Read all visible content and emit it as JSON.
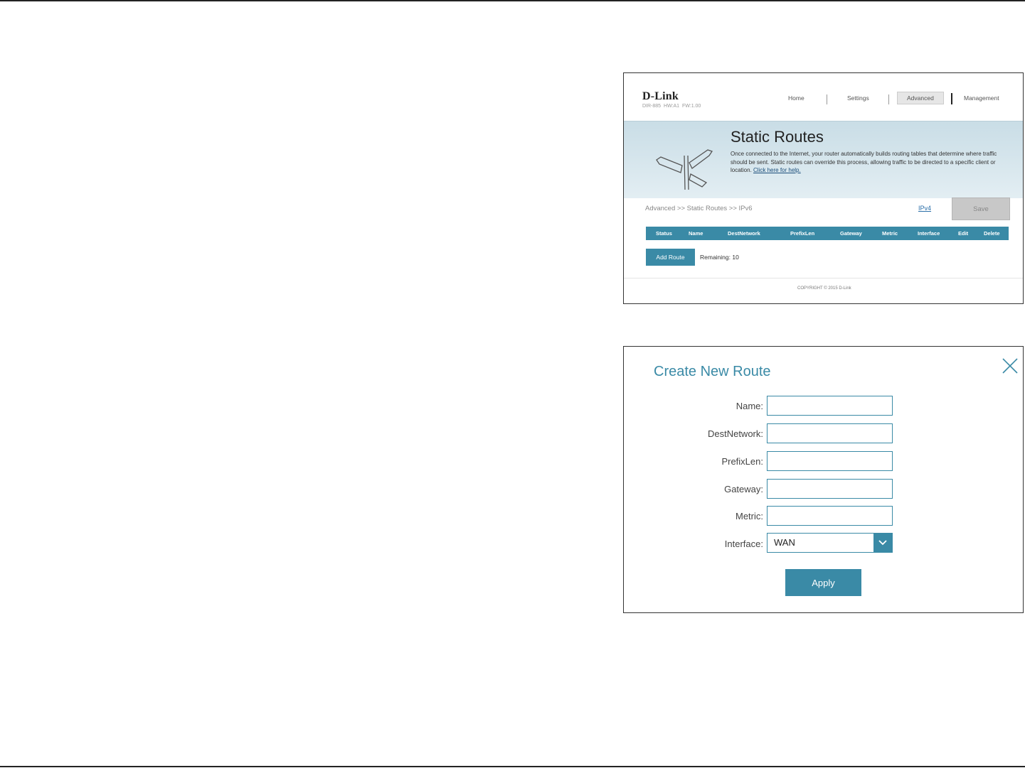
{
  "static_routes": {
    "logo": "D-Link",
    "model_info": "DIR-885   HW:A1   FW:1.00",
    "nav": {
      "home": "Home",
      "settings": "Settings",
      "advanced": "Advanced",
      "management": "Management"
    },
    "banner": {
      "title": "Static Routes",
      "description": "Once connected to the Internet, your router automatically builds routing tables that determine where traffic should be sent. Static routes can override this process, allowing traffic to be directed to a specific client or location.",
      "help_link": "Click here for help."
    },
    "breadcrumb": "Advanced >> Static Routes >> IPv6",
    "ipv4_link": "IPv4",
    "save_label": "Save",
    "table_headers": [
      "Status",
      "Name",
      "DestNetwork",
      "PrefixLen",
      "Gateway",
      "Metric",
      "Interface",
      "Edit",
      "Delete"
    ],
    "add_route_label": "Add Route",
    "remaining": "Remaining: 10",
    "copyright": "COPYRIGHT © 2015 D-Link"
  },
  "create_route": {
    "title": "Create New Route",
    "labels": {
      "name": "Name:",
      "dest_network": "DestNetwork:",
      "prefix_len": "PrefixLen:",
      "gateway": "Gateway:",
      "metric": "Metric:",
      "interface": "Interface:"
    },
    "values": {
      "name": "",
      "dest_network": "",
      "prefix_len": "",
      "gateway": "",
      "metric": ""
    },
    "interface_selected": "WAN",
    "apply_label": "Apply"
  },
  "colors": {
    "accent": "#3a8aa6",
    "banner_top": "#c9dde6",
    "save_disabled": "#c8c8c8"
  }
}
